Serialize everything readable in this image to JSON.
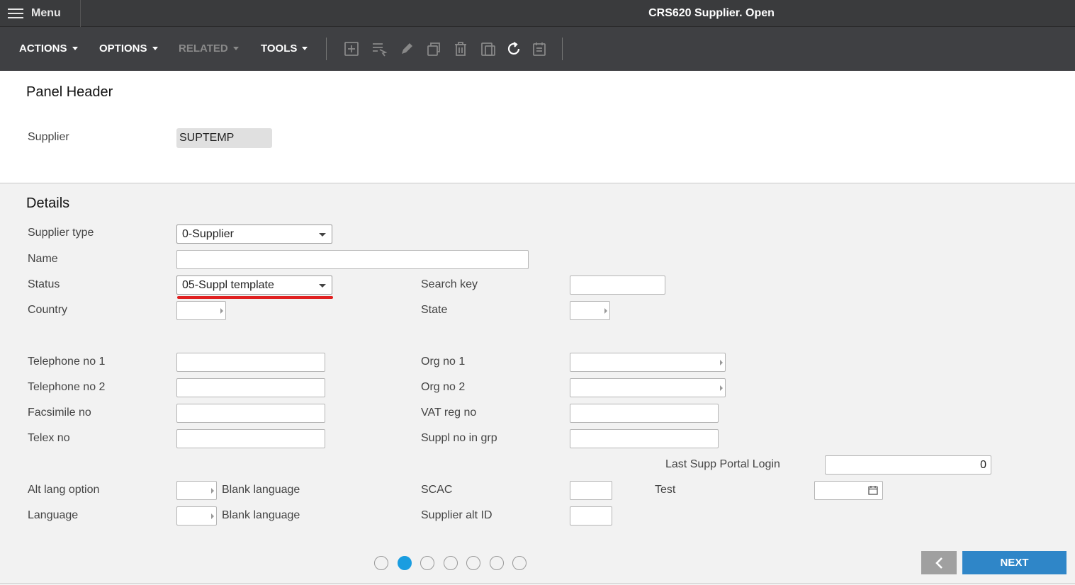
{
  "menu": {
    "label": "Menu"
  },
  "app_title": "CRS620 Supplier. Open",
  "toolbar": {
    "menus": [
      {
        "label": "ACTIONS",
        "enabled": true
      },
      {
        "label": "OPTIONS",
        "enabled": true
      },
      {
        "label": "RELATED",
        "enabled": false
      },
      {
        "label": "TOOLS",
        "enabled": true
      }
    ],
    "icons": [
      "add-icon",
      "select-icon",
      "edit-icon",
      "copy-icon",
      "delete-icon",
      "duplicate-icon",
      "refresh-icon",
      "notes-icon"
    ]
  },
  "panel_header": {
    "title": "Panel Header",
    "supplier_label": "Supplier",
    "supplier_value": "SUPTEMP"
  },
  "details": {
    "title": "Details",
    "supplier_type": {
      "label": "Supplier type",
      "value": "0-Supplier"
    },
    "name": {
      "label": "Name",
      "value": ""
    },
    "status": {
      "label": "Status",
      "value": "05-Suppl template"
    },
    "search_key": {
      "label": "Search key",
      "value": ""
    },
    "country": {
      "label": "Country",
      "value": ""
    },
    "state": {
      "label": "State",
      "value": ""
    },
    "telephone_1": {
      "label": "Telephone no 1",
      "value": ""
    },
    "telephone_2": {
      "label": "Telephone no 2",
      "value": ""
    },
    "facsimile": {
      "label": "Facsimile no",
      "value": ""
    },
    "telex": {
      "label": "Telex no",
      "value": ""
    },
    "org_no_1": {
      "label": "Org no 1",
      "value": ""
    },
    "org_no_2": {
      "label": "Org no 2",
      "value": ""
    },
    "vat_reg": {
      "label": "VAT reg no",
      "value": ""
    },
    "suppl_no_grp": {
      "label": "Suppl no in grp",
      "value": ""
    },
    "last_portal_login": {
      "label": "Last Supp Portal Login",
      "value": "0"
    },
    "alt_lang": {
      "label": "Alt lang option",
      "value": "",
      "desc": "Blank language"
    },
    "language": {
      "label": "Language",
      "value": "",
      "desc": "Blank language"
    },
    "scac": {
      "label": "SCAC",
      "value": ""
    },
    "supplier_alt_id": {
      "label": "Supplier alt ID",
      "value": ""
    },
    "test": {
      "label": "Test",
      "value": ""
    }
  },
  "pager": {
    "total": 7,
    "current": 2
  },
  "buttons": {
    "next": "NEXT"
  },
  "colors": {
    "accent": "#2f86c8",
    "active_dot": "#1a9de0",
    "highlight": "#e02020"
  }
}
